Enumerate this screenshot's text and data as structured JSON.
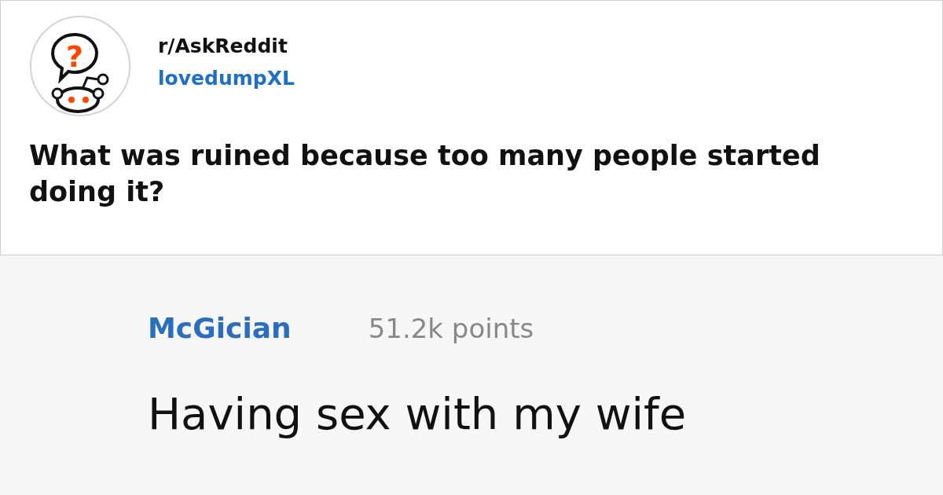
{
  "post": {
    "icon_glyph": "?",
    "subreddit": "r/AskReddit",
    "author": "lovedumpXL",
    "title": "What was ruined because too many people started doing it?"
  },
  "comment": {
    "author": "McGician",
    "points": "51.2k points",
    "body": "Having sex with my wife"
  }
}
